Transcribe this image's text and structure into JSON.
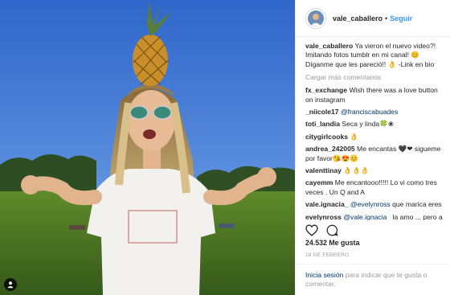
{
  "post": {
    "username": "vale_caballero",
    "dot": "•",
    "follow_label": "Seguir",
    "caption_user": "vale_caballero",
    "caption_text": "Ya vieron el nuevo video?! Imitando fotos tumblr en mi canal! 😊 Díganme que les pareció!! 👌 -Link en bio",
    "load_more_label": "Cargar más comentarios",
    "comments": [
      {
        "user": "fx_exchange",
        "text": "Wish there was a love button on instagram",
        "mention": ""
      },
      {
        "user": "_niicole17",
        "text": "",
        "mention": "@franciscabuades"
      },
      {
        "user": "toti_landia",
        "text": "Seca y linda🍀❀",
        "mention": ""
      },
      {
        "user": "citygirlcooks",
        "text": "👌",
        "mention": ""
      },
      {
        "user": "andrea_242005",
        "text": "Me encantas 🖤❤ sigueme por favor😘😍😊",
        "mention": ""
      },
      {
        "user": "valenttinay",
        "text": "👌👌👌",
        "mention": ""
      },
      {
        "user": "cayemm",
        "text": "Me encantooo!!!!! Lo vi como tres veces . Un Q and A",
        "mention": ""
      },
      {
        "user": "vale.ignacia_",
        "text": "que marica eres",
        "mention": "@evelynross"
      },
      {
        "user": "evelynross",
        "text": "la amo ... pero a",
        "mention": "@vale.ignacia_"
      }
    ],
    "likes_count": "24.532",
    "likes_label": "Me gusta",
    "date": "18 DE FEBRERO",
    "login_label": "Inicia sesión",
    "login_suffix": "para indicar que te gusta o comentar."
  },
  "icons": {
    "like": "heart-icon",
    "comment": "comment-bubble-icon",
    "tag": "person-tag-icon"
  },
  "colors": {
    "link_blue": "#3897f0",
    "mention_blue": "#003569",
    "muted": "#999999",
    "text": "#262626",
    "border": "#efefef"
  }
}
